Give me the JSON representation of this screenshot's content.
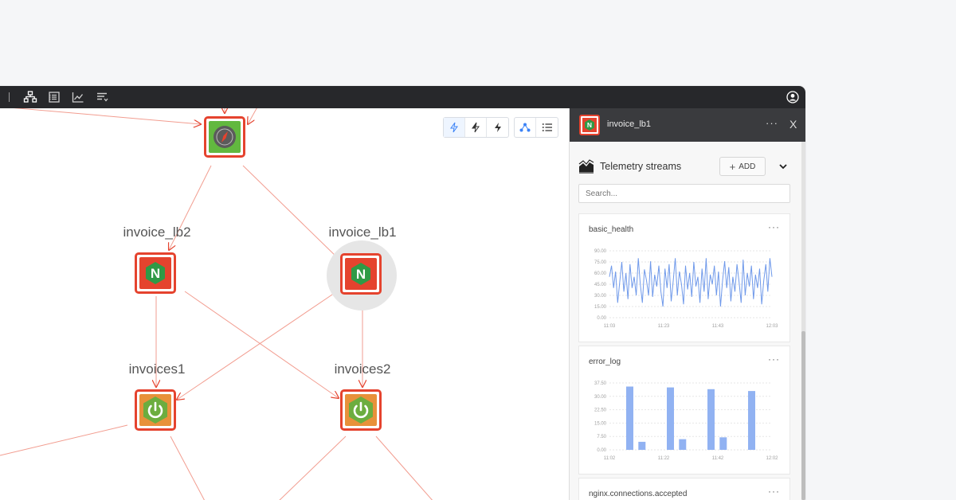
{
  "colors": {
    "accent_red": "#e5432e",
    "nginx_green": "#2f9a46",
    "spring_green": "#6cad3f",
    "compass_green": "#62b83f",
    "series_blue": "#6f99ea",
    "bar_blue": "#91b2f2"
  },
  "toolbar_icons": [
    "topology-icon",
    "list-icon",
    "chart-icon",
    "filter-icon"
  ],
  "nodes": {
    "lb2": {
      "label": "invoice_lb2",
      "glyph": "N"
    },
    "lb1": {
      "label": "invoice_lb1",
      "glyph": "N"
    },
    "inv1": {
      "label": "invoices1"
    },
    "inv2": {
      "label": "invoices2"
    }
  },
  "panel": {
    "title": "invoice_lb1",
    "more": "···",
    "close": "X",
    "telemetry_title": "Telemetry streams",
    "add_label": "ADD",
    "add_plus": "+",
    "search_placeholder": "Search..."
  },
  "cards": [
    {
      "title": "basic_health",
      "more": "···",
      "chart_data": {
        "type": "line",
        "y_ticks": [
          "90.00",
          "75.00",
          "60.00",
          "45.00",
          "30.00",
          "15.00",
          "0.00"
        ],
        "x_ticks": [
          "11:03",
          "11:23",
          "11:43",
          "12:03"
        ],
        "ylim": [
          0,
          90
        ],
        "x": [
          0,
          1,
          2,
          3,
          4,
          5,
          6,
          7,
          8,
          9,
          10,
          11,
          12,
          13,
          14,
          15,
          16,
          17,
          18,
          19,
          20,
          21,
          22,
          23,
          24,
          25,
          26,
          27,
          28,
          29,
          30,
          31,
          32,
          33,
          34,
          35,
          36,
          37,
          38,
          39,
          40,
          41,
          42,
          43,
          44,
          45,
          46,
          47,
          48,
          49,
          50,
          51,
          52,
          53,
          54,
          55,
          56,
          57,
          58,
          59,
          60,
          61,
          62,
          63,
          64,
          65,
          66,
          67,
          68,
          69,
          70,
          71,
          72,
          73,
          74,
          75,
          76,
          77,
          78,
          79
        ],
        "values": [
          55,
          70,
          40,
          62,
          20,
          48,
          75,
          35,
          60,
          25,
          72,
          40,
          55,
          30,
          80,
          45,
          20,
          65,
          50,
          30,
          76,
          28,
          58,
          42,
          70,
          35,
          15,
          66,
          40,
          72,
          22,
          50,
          80,
          30,
          62,
          45,
          18,
          70,
          38,
          60,
          28,
          75,
          42,
          55,
          20,
          66,
          35,
          80,
          25,
          58,
          45,
          70,
          30,
          62,
          15,
          50,
          76,
          40,
          68,
          22,
          55,
          35,
          72,
          48,
          20,
          78,
          30,
          60,
          42,
          70,
          25,
          58,
          40,
          66,
          18,
          50,
          72,
          35,
          80,
          55
        ]
      }
    },
    {
      "title": "error_log",
      "more": "···",
      "chart_data": {
        "type": "bar",
        "y_ticks": [
          "37.50",
          "30.00",
          "22.50",
          "15.00",
          "7.50",
          "0.00"
        ],
        "x_ticks": [
          "11:02",
          "11:22",
          "11:42",
          "12:02"
        ],
        "ylim": [
          0,
          37.5
        ],
        "x": [
          5,
          8,
          15,
          18,
          25,
          28,
          35
        ],
        "values": [
          35.5,
          4.5,
          35,
          6,
          34,
          7,
          33
        ]
      }
    },
    {
      "title": "nginx.connections.accepted",
      "more": "···"
    }
  ]
}
